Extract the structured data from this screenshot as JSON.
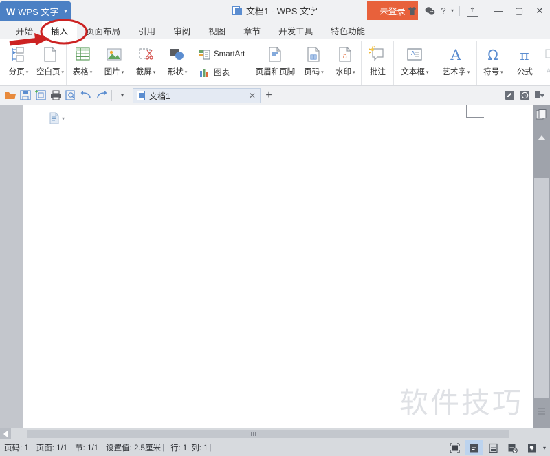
{
  "titlebar": {
    "app_tab_logo": "W",
    "app_tab_label": "WPS 文字",
    "app_tab_caret": "▾",
    "document_title": "文档1 - WPS 文字",
    "login_label": "未登录",
    "icons": [
      {
        "name": "skin-icon",
        "glyph": "♟"
      },
      {
        "name": "wechat-icon",
        "glyph": "☁"
      },
      {
        "name": "help-icon",
        "glyph": "?"
      },
      {
        "name": "help-caret",
        "glyph": "▾"
      }
    ],
    "upload_icon": "↥",
    "window_buttons": {
      "minimize": "—",
      "maximize": "▢",
      "close": "✕"
    }
  },
  "ribbon_tabs": [
    {
      "label": "开始",
      "active": false
    },
    {
      "label": "插入",
      "active": true
    },
    {
      "label": "页面布局",
      "active": false
    },
    {
      "label": "引用",
      "active": false
    },
    {
      "label": "审阅",
      "active": false
    },
    {
      "label": "视图",
      "active": false
    },
    {
      "label": "章节",
      "active": false
    },
    {
      "label": "开发工具",
      "active": false
    },
    {
      "label": "特色功能",
      "active": false
    }
  ],
  "ribbon": {
    "group1": [
      {
        "label": "分页",
        "icon": "page-break-icon",
        "caret": "▾"
      },
      {
        "label": "空白页",
        "icon": "blank-page-icon",
        "caret": "▾"
      }
    ],
    "group2": [
      {
        "label": "表格",
        "icon": "table-icon",
        "caret": "▾"
      },
      {
        "label": "图片",
        "icon": "picture-icon",
        "caret": "▾"
      },
      {
        "label": "截屏",
        "icon": "screenshot-icon",
        "caret": "▾"
      },
      {
        "label": "形状",
        "icon": "shapes-icon",
        "caret": "▾"
      }
    ],
    "group2_stack": [
      {
        "label": "SmartArt",
        "icon": "smartart-icon"
      },
      {
        "label": "图表",
        "icon": "chart-icon"
      }
    ],
    "group3": [
      {
        "label": "页眉和页脚",
        "icon": "header-footer-icon",
        "caret": ""
      },
      {
        "label": "页码",
        "icon": "page-number-icon",
        "caret": "▾"
      },
      {
        "label": "水印",
        "icon": "watermark-icon",
        "caret": "▾"
      }
    ],
    "group4": [
      {
        "label": "批注",
        "icon": "comment-icon",
        "caret": ""
      }
    ],
    "group5": [
      {
        "label": "文本框",
        "icon": "textbox-icon",
        "caret": "▾"
      },
      {
        "label": "艺术字",
        "icon": "wordart-icon",
        "caret": "▾"
      }
    ],
    "group6": [
      {
        "label": "符号",
        "icon": "symbol-icon",
        "caret": "▾"
      },
      {
        "label": "公式",
        "icon": "formula-icon",
        "caret": ""
      }
    ],
    "overflow_caret": "›"
  },
  "quickbar": {
    "icons": [
      {
        "name": "open-folder-icon",
        "glyph": "📂"
      },
      {
        "name": "save-icon",
        "glyph": "💾"
      },
      {
        "name": "save-as-icon",
        "glyph": "🖫"
      },
      {
        "name": "print-icon",
        "glyph": "🖨"
      },
      {
        "name": "print-preview-icon",
        "glyph": "🔍"
      },
      {
        "name": "undo-icon",
        "glyph": "↶"
      },
      {
        "name": "redo-icon",
        "glyph": "↷"
      }
    ],
    "dropdown_caret": "▾",
    "doc_tab": {
      "name": "文档1",
      "close": "✕"
    },
    "new_tab": "+",
    "right_icons": [
      {
        "name": "edit-mode-icon",
        "glyph": "🖉"
      },
      {
        "name": "history-icon",
        "glyph": "🕑"
      },
      {
        "name": "collapse-ribbon-icon",
        "glyph": "⏷"
      }
    ]
  },
  "document": {
    "paste_options_icon": "paste-options-icon",
    "paste_caret": "▾",
    "watermark_text": "软件技巧"
  },
  "statusbar": {
    "fields": [
      "页码: 1",
      "页面: 1/1",
      "节: 1/1",
      "设置值: 2.5厘米",
      "行: 1",
      "列: 1"
    ],
    "view_buttons": [
      {
        "name": "fullscreen-view-button",
        "glyph": "⛶",
        "active": false
      },
      {
        "name": "page-view-button",
        "glyph": "▤",
        "active": true
      },
      {
        "name": "outline-view-button",
        "glyph": "▥",
        "active": false
      },
      {
        "name": "web-view-button",
        "glyph": "▦",
        "active": false
      },
      {
        "name": "night-mode-button",
        "glyph": "💡",
        "active": false
      }
    ],
    "night_caret": "▾"
  },
  "annotation": {
    "highlight_target": "插入",
    "color": "#cc2222"
  },
  "colors": {
    "accent_blue": "#4b80c4",
    "login_orange": "#e8613b",
    "ribbon_bg": "#ffffff",
    "chrome_bg": "#f0f1f3",
    "status_bg": "#d7dade"
  }
}
